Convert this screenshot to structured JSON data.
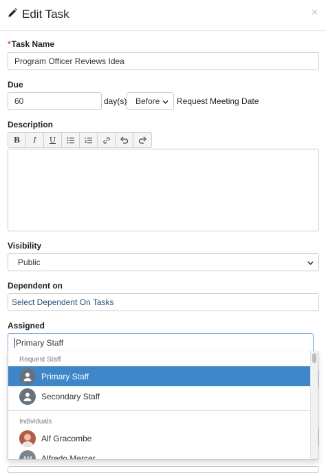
{
  "header": {
    "title": "Edit Task",
    "close": "×"
  },
  "task_name": {
    "label": "Task Name",
    "required_mark": "*",
    "value": "Program Officer Reviews Idea"
  },
  "due": {
    "label": "Due",
    "value": "60",
    "unit": "day(s)",
    "relation": "Before",
    "anchor": "Request Meeting Date"
  },
  "description": {
    "label": "Description",
    "toolbar": [
      "bold-icon",
      "italic-icon",
      "underline-icon",
      "bullet-list-icon",
      "numbered-list-icon",
      "link-icon",
      "undo-icon",
      "redo-icon"
    ],
    "value": ""
  },
  "visibility": {
    "label": "Visibility",
    "value": "Public"
  },
  "dependent": {
    "label": "Dependent on",
    "placeholder": "Select Dependent On Tasks"
  },
  "assigned": {
    "label": "Assigned",
    "value": "Primary Staff",
    "groups": [
      {
        "label": "Request Staff",
        "options": [
          {
            "label": "Primary Staff",
            "selected": true
          },
          {
            "label": "Secondary Staff",
            "selected": false
          }
        ]
      },
      {
        "label": "Individuals",
        "options": [
          {
            "label": "Alf Gracombe",
            "avatar": "photo"
          },
          {
            "label": "Alfredo Mercer",
            "avatar": "AM"
          }
        ]
      }
    ]
  },
  "colors": {
    "accent": "#3c86c9",
    "required": "#d9534f",
    "link": "#1f4e79"
  }
}
